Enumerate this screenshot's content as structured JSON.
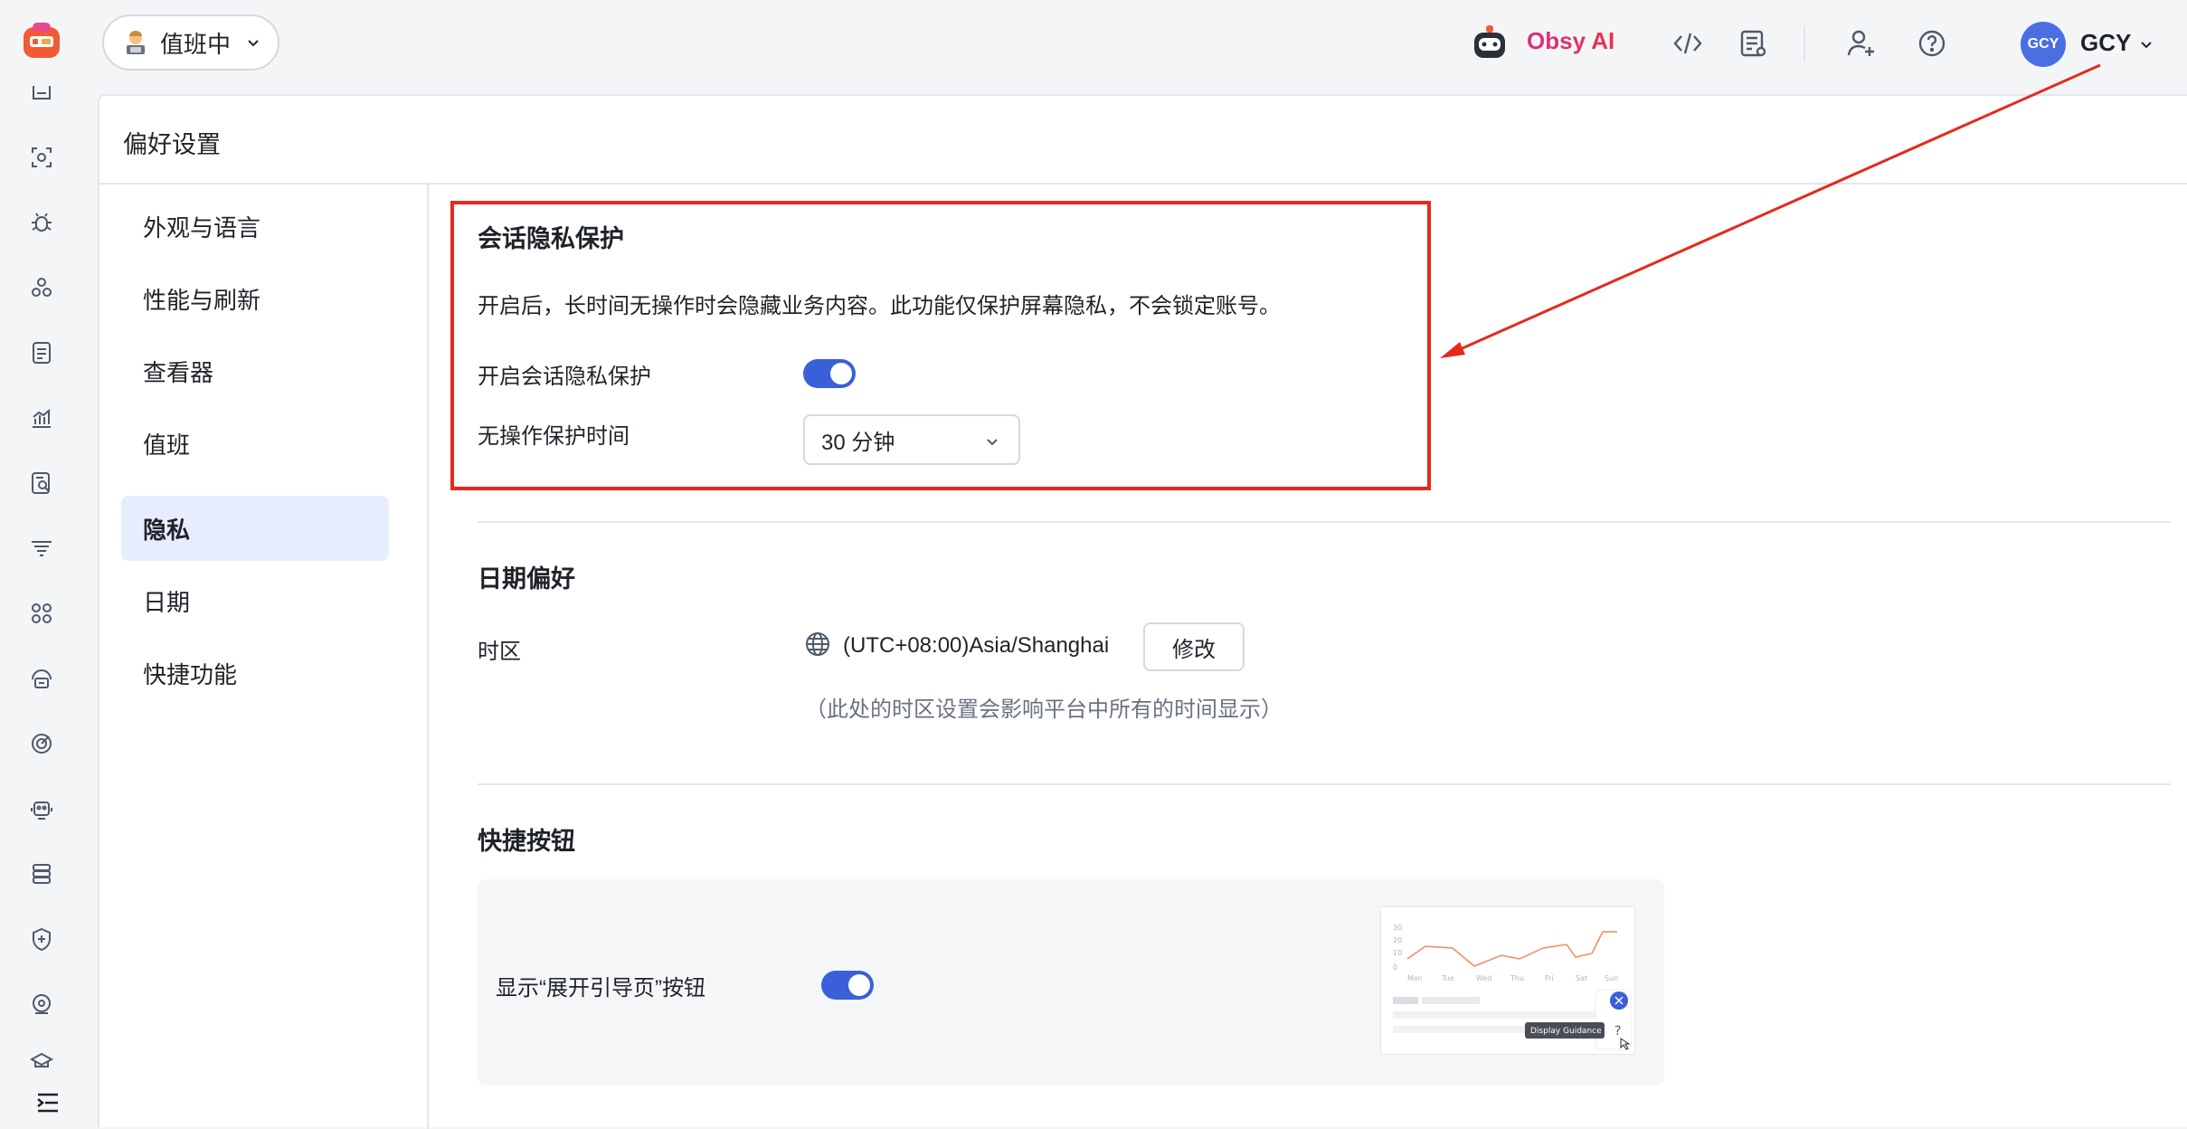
{
  "topbar": {
    "duty_status": "值班中",
    "ai_name": "Obsy AI",
    "user_initials": "GCY",
    "user_name": "GCY"
  },
  "page": {
    "title": "偏好设置"
  },
  "nav": {
    "items": [
      {
        "label": "外观与语言"
      },
      {
        "label": "性能与刷新"
      },
      {
        "label": "查看器"
      },
      {
        "label": "值班"
      },
      {
        "label": "隐私"
      },
      {
        "label": "日期"
      },
      {
        "label": "快捷功能"
      }
    ]
  },
  "privacy": {
    "title": "会话隐私保护",
    "description": "开启后，长时间无操作时会隐藏业务内容。此功能仅保护屏幕隐私，不会锁定账号。",
    "toggle_label": "开启会话隐私保护",
    "toggle_on": true,
    "timeout_label": "无操作保护时间",
    "timeout_value": "30 分钟"
  },
  "date": {
    "title": "日期偏好",
    "timezone_label": "时区",
    "timezone_value": "(UTC+08:00)Asia/Shanghai",
    "edit_button": "修改",
    "timezone_note": "（此处的时区设置会影响平台中所有的时间显示）"
  },
  "quick": {
    "title": "快捷按钮",
    "guide_toggle_label": "显示“展开引导页”按钮",
    "guide_toggle_on": true,
    "preview_tooltip": "Display Guidance",
    "preview_axis_days": [
      "Mon",
      "Tue",
      "Wed",
      "Thu",
      "Fri",
      "Sat",
      "Sun"
    ],
    "preview_axis_values": [
      "30",
      "20",
      "10",
      "0"
    ]
  },
  "colors": {
    "accent": "#3a5fd9",
    "highlight": "#e52a1d",
    "active_nav_bg": "#e8edfd"
  }
}
